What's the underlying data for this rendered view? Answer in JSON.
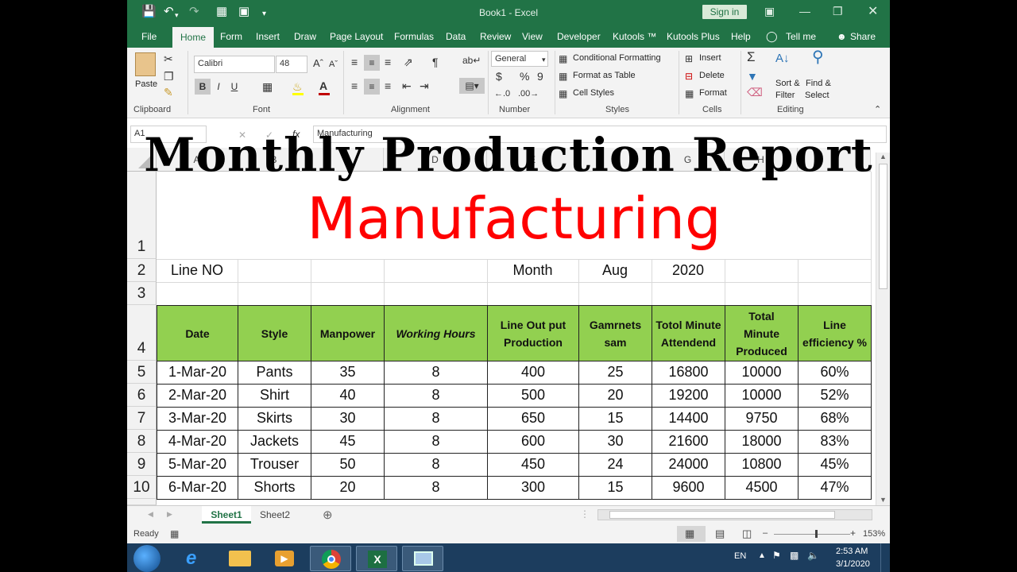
{
  "titlebar": {
    "doc_title": "Book1  -  Excel",
    "sign_in": "Sign in"
  },
  "tabs": [
    "File",
    "Home",
    "Form",
    "Insert",
    "Draw",
    "Page Layout",
    "Formulas",
    "Data",
    "Review",
    "View",
    "Developer",
    "Kutools ™",
    "Kutools Plus",
    "Help",
    "Tell me",
    "Share"
  ],
  "ribbon": {
    "clipboard": {
      "paste": "Paste",
      "label": "Clipboard"
    },
    "font": {
      "name": "Calibri",
      "size": "48",
      "label": "Font",
      "bold": "B",
      "italic": "I",
      "underline": "U"
    },
    "alignment": {
      "label": "Alignment"
    },
    "number": {
      "format": "General",
      "label": "Number",
      "dollar": "$",
      "percent": "%",
      "comma": "9"
    },
    "styles": {
      "conditional": "Conditional Formatting",
      "table": "Format as Table",
      "cell": "Cell Styles",
      "label": "Styles"
    },
    "cells": {
      "insert": "Insert",
      "delete": "Delete",
      "format": "Format",
      "label": "Cells"
    },
    "editing": {
      "sort": "Sort &",
      "filter": "Filter",
      "find": "Find &",
      "select": "Select",
      "label": "Editing"
    }
  },
  "formula_bar": {
    "name_box": "A1",
    "fx": "fx",
    "formula": "Manufacturing"
  },
  "overlay_title": "Monthly Production Report",
  "sheet": {
    "columns": [
      "A",
      "B",
      "C",
      "D",
      "E",
      "F",
      "G",
      "H",
      "I"
    ],
    "rows": [
      "1",
      "2",
      "3",
      "4",
      "5",
      "6",
      "7",
      "8",
      "9",
      "10"
    ],
    "banner": "Manufacturing",
    "row2": {
      "line_no": "Line NO",
      "month_label": "Month",
      "month": "Aug",
      "year": "2020"
    },
    "headers": [
      "Date",
      "Style",
      "Manpower",
      "Working Hours",
      "Line Out put Production",
      "Gamrnets sam",
      "Totol Minute Attendend",
      "Total Minute Produced",
      "Line efficiency %"
    ],
    "data": [
      [
        "1-Mar-20",
        "Pants",
        "35",
        "8",
        "400",
        "25",
        "16800",
        "10000",
        "60%"
      ],
      [
        "2-Mar-20",
        "Shirt",
        "40",
        "8",
        "500",
        "20",
        "19200",
        "10000",
        "52%"
      ],
      [
        "3-Mar-20",
        "Skirts",
        "30",
        "8",
        "650",
        "15",
        "14400",
        "9750",
        "68%"
      ],
      [
        "4-Mar-20",
        "Jackets",
        "45",
        "8",
        "600",
        "30",
        "21600",
        "18000",
        "83%"
      ],
      [
        "5-Mar-20",
        "Trouser",
        "50",
        "8",
        "450",
        "24",
        "24000",
        "10800",
        "45%"
      ],
      [
        "6-Mar-20",
        "Shorts",
        "20",
        "8",
        "300",
        "15",
        "9600",
        "4500",
        "47%"
      ]
    ]
  },
  "sheet_tabs": [
    "Sheet1",
    "Sheet2"
  ],
  "status": {
    "ready": "Ready",
    "zoom": "153%"
  },
  "taskbar": {
    "lang": "EN",
    "time": "2:53 AM",
    "date": "3/1/2020"
  },
  "colors": {
    "excel_green": "#217346",
    "header_fill": "#92d050",
    "banner_red": "#ff0000"
  }
}
